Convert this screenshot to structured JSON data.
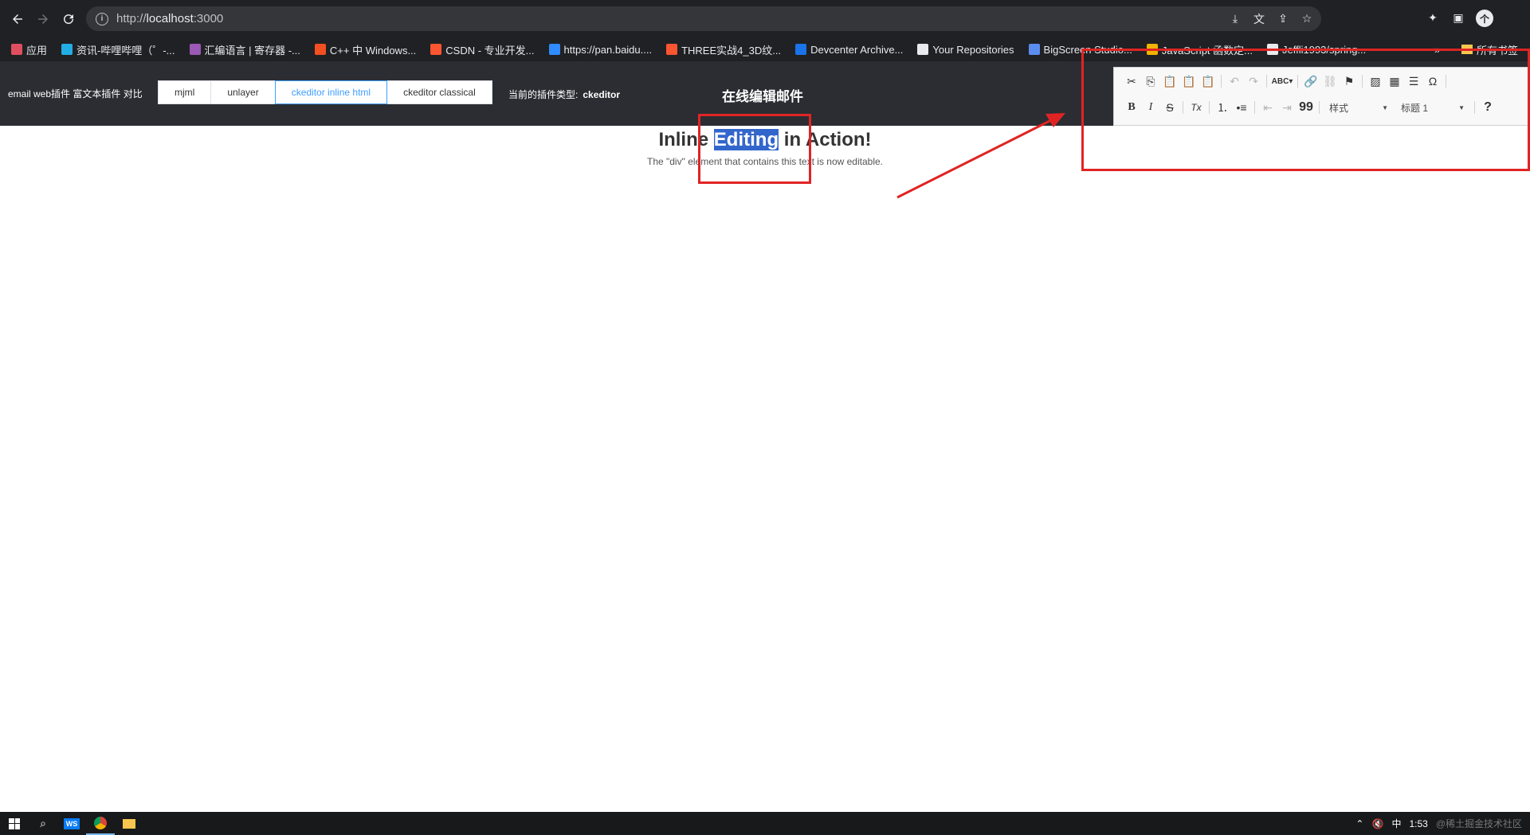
{
  "browser": {
    "url_scheme": "http://",
    "url_host": "localhost",
    "url_port": ":3000"
  },
  "bookmarks": [
    {
      "label": "应用",
      "color": "#e04f5f"
    },
    {
      "label": "资讯-哔哩哔哩（゜-...",
      "color": "#23ade5"
    },
    {
      "label": "汇编语言 | 寄存器 -...",
      "color": "#9b59b6"
    },
    {
      "label": "C++ 中 Windows...",
      "color": "#f25022"
    },
    {
      "label": "CSDN - 专业开发...",
      "color": "#fc5531"
    },
    {
      "label": "https://pan.baidu....",
      "color": "#2f8bff"
    },
    {
      "label": "THREE实战4_3D纹...",
      "color": "#fc5531"
    },
    {
      "label": "Devcenter Archive...",
      "color": "#1a73e8"
    },
    {
      "label": "Your Repositories",
      "color": "#e8eaed"
    },
    {
      "label": "BigScreen Studio...",
      "color": "#5b8def"
    },
    {
      "label": "JavaScript 函数定...",
      "color": "#f0b400"
    },
    {
      "label": "Jeffli1993/spring...",
      "color": "#e8eaed"
    }
  ],
  "bookmarks_more": "»",
  "bookmarks_other": "所有书签",
  "app": {
    "title": "email web插件 富文本插件 对比",
    "tabs": [
      "mjml",
      "unlayer",
      "ckeditor inline html",
      "ckeditor classical"
    ],
    "active_tab_index": 2,
    "plugin_type_label": "当前的插件类型:",
    "plugin_type_value": "ckeditor",
    "center_title": "在线编辑邮件"
  },
  "toolbar": {
    "row1": [
      "cut-icon",
      "copy-icon",
      "paste-icon",
      "paste-text-icon",
      "paste-word-icon",
      "undo-icon",
      "redo-icon",
      "spellcheck-icon",
      "link-icon",
      "unlink-icon",
      "anchor-icon",
      "image-icon",
      "table-icon",
      "horizontal-line-icon",
      "special-char-icon"
    ],
    "styles_combo": "样式",
    "format_combo": "标题 1",
    "bold": "B",
    "italic": "I",
    "strike": "S",
    "remove_format": "Tx",
    "blockquote": "99",
    "help": "?"
  },
  "content": {
    "heading_before": "Inline ",
    "heading_selected": "Editing",
    "heading_after": " in Action!",
    "paragraph": "The \"div\" element that contains this text is now editable."
  },
  "taskbar": {
    "tray_ime": "中",
    "tray_time": "1:53",
    "watermark": "@稀土掘金技术社区"
  },
  "annotation_color": "#e02424"
}
